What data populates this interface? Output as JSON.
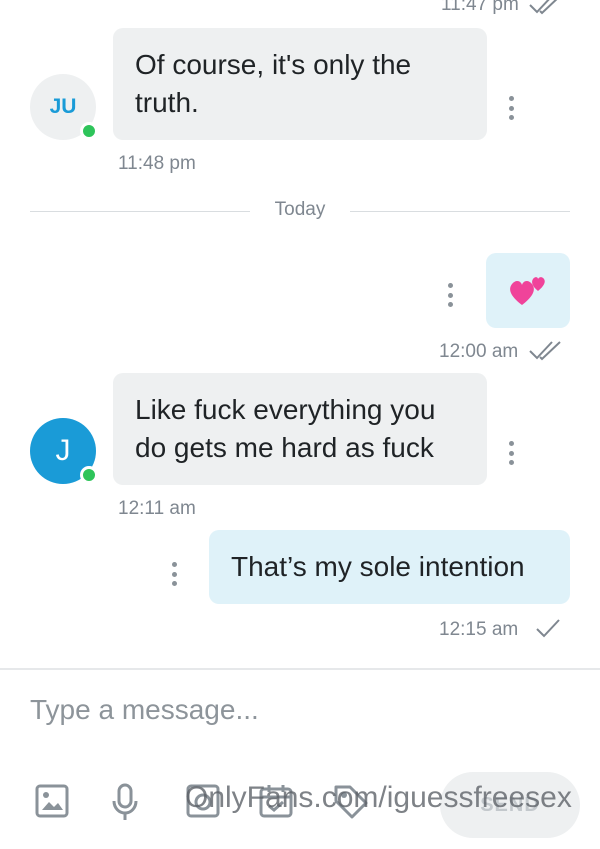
{
  "messages": [
    {
      "time": "11:47 pm"
    },
    {
      "avatar": "JU",
      "text_line1": "Of course, it's only the",
      "text_line2": "truth.",
      "time": "11:48 pm"
    },
    {
      "divider": "Today"
    },
    {
      "emoji": "💕",
      "time": "12:00 am"
    },
    {
      "avatar": "J",
      "text_line1": "Like fuck everything you",
      "text_line2": "do gets me hard as fuck",
      "time": "12:11 am"
    },
    {
      "text": "That’s my sole intention",
      "time": "12:15 am"
    }
  ],
  "composer": {
    "placeholder": "Type a message...",
    "send_label": "SEND"
  },
  "watermark": "OnlyFans.com/iguessfreesex",
  "colors": {
    "accent": "#1a9bd7",
    "online": "#2ec45a",
    "incoming_bubble": "#eef0f1",
    "outgoing_bubble": "#dff2f9"
  },
  "icons": [
    "double-check-icon",
    "more-vert-icon",
    "image-icon",
    "microphone-icon",
    "camera-icon",
    "calendar-icon",
    "tag-icon",
    "check-icon"
  ]
}
